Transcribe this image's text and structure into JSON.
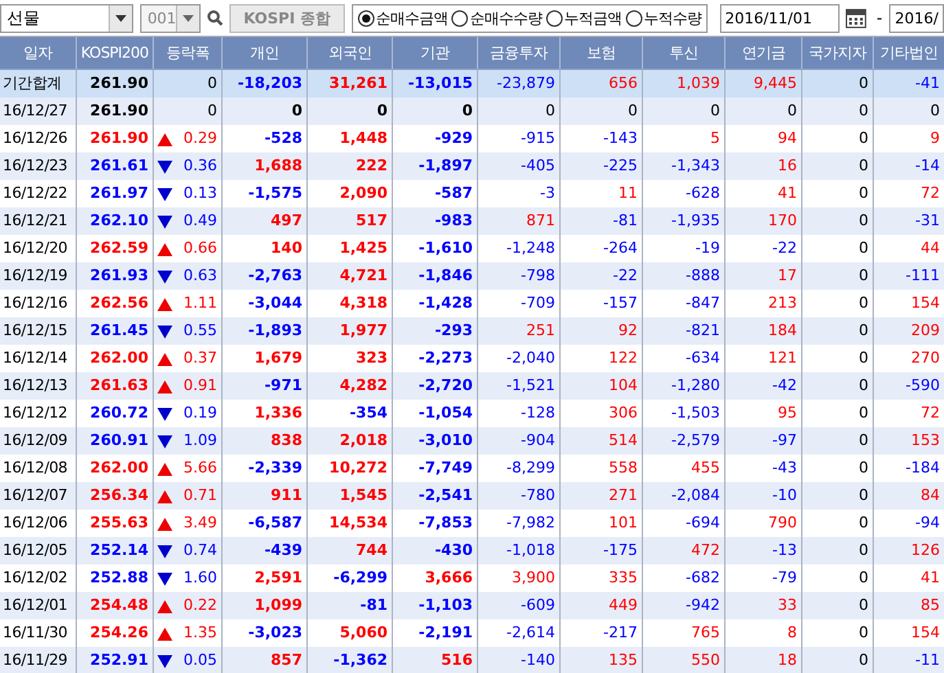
{
  "toolbar": {
    "market": "선물",
    "code": "001",
    "index_button": "KOSPI 종합",
    "options": [
      {
        "label": "순매수금액",
        "selected": true
      },
      {
        "label": "순매수수량",
        "selected": false
      },
      {
        "label": "누적금액",
        "selected": false
      },
      {
        "label": "누적수량",
        "selected": false
      }
    ],
    "date_from": "2016/11/01",
    "separator": "-",
    "date_to": "2016/"
  },
  "table": {
    "columns": [
      "일자",
      "KOSPI200",
      "등락폭",
      "개인",
      "외국인",
      "기관",
      "금융투자",
      "보험",
      "투신",
      "연기금",
      "국가지자",
      "기타법인"
    ],
    "rows": [
      {
        "kind": "total",
        "date": "기간합계",
        "kospi": "261.90",
        "change": "0",
        "values": [
          "-18,203",
          "31,261",
          "-13,015",
          "-23,879",
          "656",
          "1,039",
          "9,445",
          "0",
          "-41"
        ]
      },
      {
        "kind": "flat",
        "date": "16/12/27",
        "kospi": "261.90",
        "change": "0",
        "values": [
          "0",
          "0",
          "0",
          "0",
          "0",
          "0",
          "0",
          "0",
          "0"
        ]
      },
      {
        "kind": "up",
        "date": "16/12/26",
        "kospi": "261.90",
        "change": "0.29",
        "values": [
          "-528",
          "1,448",
          "-929",
          "-915",
          "-143",
          "5",
          "94",
          "0",
          "9"
        ]
      },
      {
        "kind": "down",
        "date": "16/12/23",
        "kospi": "261.61",
        "change": "0.36",
        "values": [
          "1,688",
          "222",
          "-1,897",
          "-405",
          "-225",
          "-1,343",
          "16",
          "0",
          "-14"
        ]
      },
      {
        "kind": "down",
        "date": "16/12/22",
        "kospi": "261.97",
        "change": "0.13",
        "values": [
          "-1,575",
          "2,090",
          "-587",
          "-3",
          "11",
          "-628",
          "41",
          "0",
          "72"
        ]
      },
      {
        "kind": "down",
        "date": "16/12/21",
        "kospi": "262.10",
        "change": "0.49",
        "values": [
          "497",
          "517",
          "-983",
          "871",
          "-81",
          "-1,935",
          "170",
          "0",
          "-31"
        ]
      },
      {
        "kind": "up",
        "date": "16/12/20",
        "kospi": "262.59",
        "change": "0.66",
        "values": [
          "140",
          "1,425",
          "-1,610",
          "-1,248",
          "-264",
          "-19",
          "-22",
          "0",
          "44"
        ]
      },
      {
        "kind": "down",
        "date": "16/12/19",
        "kospi": "261.93",
        "change": "0.63",
        "values": [
          "-2,763",
          "4,721",
          "-1,846",
          "-798",
          "-22",
          "-888",
          "17",
          "0",
          "-111"
        ]
      },
      {
        "kind": "up",
        "date": "16/12/16",
        "kospi": "262.56",
        "change": "1.11",
        "values": [
          "-3,044",
          "4,318",
          "-1,428",
          "-709",
          "-157",
          "-847",
          "213",
          "0",
          "154"
        ]
      },
      {
        "kind": "down",
        "date": "16/12/15",
        "kospi": "261.45",
        "change": "0.55",
        "values": [
          "-1,893",
          "1,977",
          "-293",
          "251",
          "92",
          "-821",
          "184",
          "0",
          "209"
        ]
      },
      {
        "kind": "up",
        "date": "16/12/14",
        "kospi": "262.00",
        "change": "0.37",
        "values": [
          "1,679",
          "323",
          "-2,273",
          "-2,040",
          "122",
          "-634",
          "121",
          "0",
          "270"
        ]
      },
      {
        "kind": "up",
        "date": "16/12/13",
        "kospi": "261.63",
        "change": "0.91",
        "values": [
          "-971",
          "4,282",
          "-2,720",
          "-1,521",
          "104",
          "-1,280",
          "-42",
          "0",
          "-590"
        ]
      },
      {
        "kind": "down",
        "date": "16/12/12",
        "kospi": "260.72",
        "change": "0.19",
        "values": [
          "1,336",
          "-354",
          "-1,054",
          "-128",
          "306",
          "-1,503",
          "95",
          "0",
          "72"
        ]
      },
      {
        "kind": "down",
        "date": "16/12/09",
        "kospi": "260.91",
        "change": "1.09",
        "values": [
          "838",
          "2,018",
          "-3,010",
          "-904",
          "514",
          "-2,579",
          "-97",
          "0",
          "153"
        ]
      },
      {
        "kind": "up",
        "date": "16/12/08",
        "kospi": "262.00",
        "change": "5.66",
        "values": [
          "-2,339",
          "10,272",
          "-7,749",
          "-8,299",
          "558",
          "455",
          "-43",
          "0",
          "-184"
        ]
      },
      {
        "kind": "up",
        "date": "16/12/07",
        "kospi": "256.34",
        "change": "0.71",
        "values": [
          "911",
          "1,545",
          "-2,541",
          "-780",
          "271",
          "-2,084",
          "-10",
          "0",
          "84"
        ]
      },
      {
        "kind": "up",
        "date": "16/12/06",
        "kospi": "255.63",
        "change": "3.49",
        "values": [
          "-6,587",
          "14,534",
          "-7,853",
          "-7,982",
          "101",
          "-694",
          "790",
          "0",
          "-94"
        ]
      },
      {
        "kind": "down",
        "date": "16/12/05",
        "kospi": "252.14",
        "change": "0.74",
        "values": [
          "-439",
          "744",
          "-430",
          "-1,018",
          "-175",
          "472",
          "-13",
          "0",
          "126"
        ]
      },
      {
        "kind": "down",
        "date": "16/12/02",
        "kospi": "252.88",
        "change": "1.60",
        "values": [
          "2,591",
          "-6,299",
          "3,666",
          "3,900",
          "335",
          "-682",
          "-79",
          "0",
          "41"
        ]
      },
      {
        "kind": "up",
        "date": "16/12/01",
        "kospi": "254.48",
        "change": "0.22",
        "values": [
          "1,099",
          "-81",
          "-1,103",
          "-609",
          "449",
          "-942",
          "33",
          "0",
          "85"
        ]
      },
      {
        "kind": "up",
        "date": "16/11/30",
        "kospi": "254.26",
        "change": "1.35",
        "values": [
          "-3,023",
          "5,060",
          "-2,191",
          "-2,614",
          "-217",
          "765",
          "8",
          "0",
          "154"
        ]
      },
      {
        "kind": "down",
        "date": "16/11/29",
        "kospi": "252.91",
        "change": "0.05",
        "values": [
          "857",
          "-1,362",
          "516",
          "-140",
          "135",
          "550",
          "18",
          "0",
          "-11"
        ]
      }
    ]
  }
}
